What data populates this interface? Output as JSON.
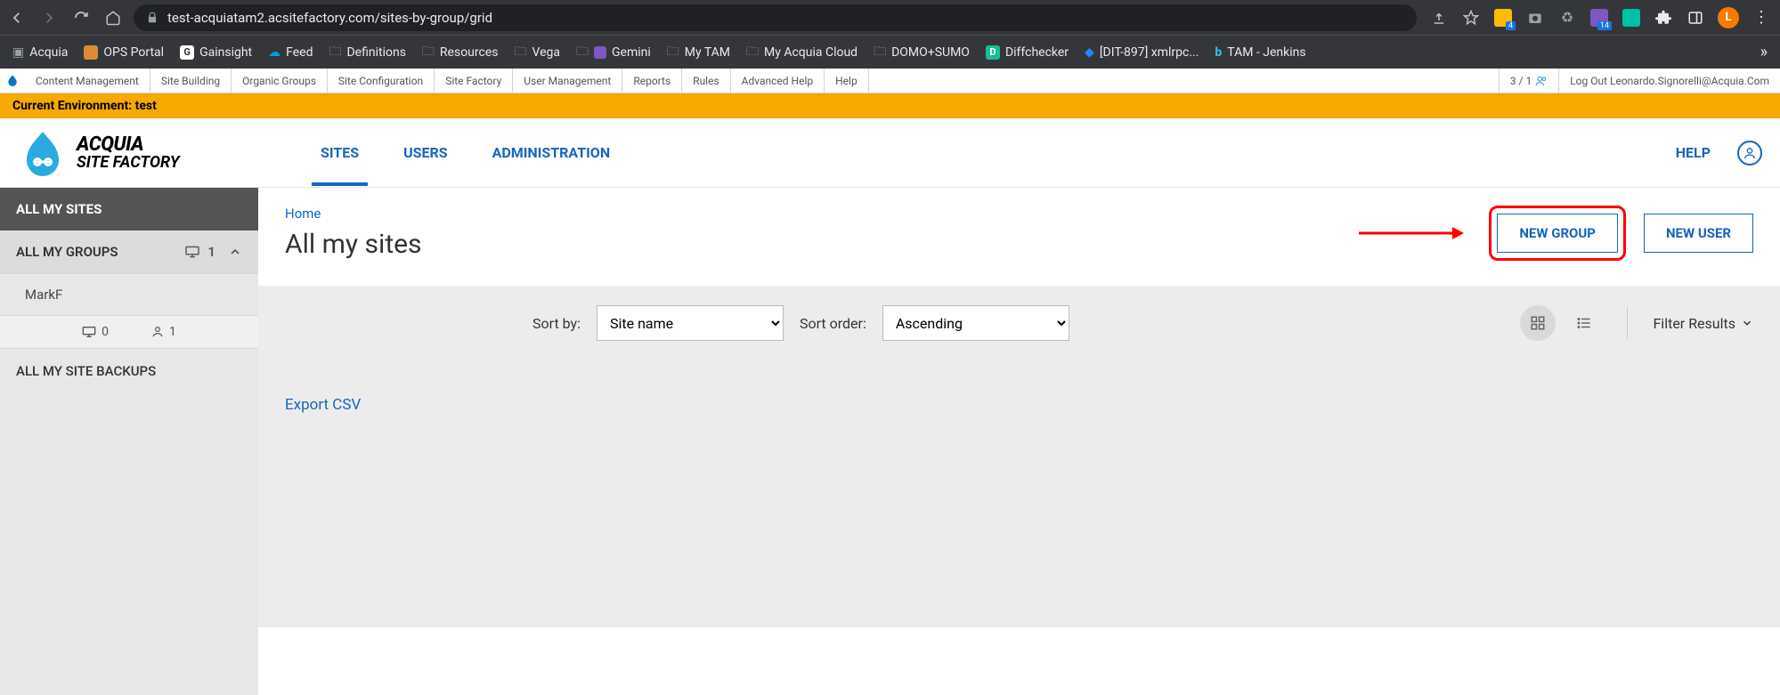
{
  "browser": {
    "url": "test-acquiatam2.acsitefactory.com/sites-by-group/grid",
    "avatar_letter": "L",
    "bookmarks": [
      {
        "label": "Acquia",
        "icon": "folder"
      },
      {
        "label": "OPS Portal",
        "icon": "orange"
      },
      {
        "label": "Gainsight",
        "icon": "white-g"
      },
      {
        "label": "Feed",
        "icon": "cloud-blue"
      },
      {
        "label": "Definitions",
        "icon": "folder"
      },
      {
        "label": "Resources",
        "icon": "folder"
      },
      {
        "label": "Vega",
        "icon": "folder"
      },
      {
        "label": "Gemini",
        "icon": "purple"
      },
      {
        "label": "My TAM",
        "icon": "folder"
      },
      {
        "label": "My Acquia Cloud",
        "icon": "folder"
      },
      {
        "label": "DOMO+SUMO",
        "icon": "folder"
      },
      {
        "label": "Diffchecker",
        "icon": "green-d"
      },
      {
        "label": "[DIT-897] xmlrpc...",
        "icon": "blue-diamond"
      },
      {
        "label": "TAM - Jenkins",
        "icon": "blue-b"
      }
    ]
  },
  "admin_bar": {
    "items": [
      "Content Management",
      "Site Building",
      "Organic Groups",
      "Site Configuration",
      "Site Factory",
      "User Management",
      "Reports",
      "Rules",
      "Advanced Help",
      "Help"
    ],
    "count": "3 / 1",
    "logout": "Log Out Leonardo.Signorelli@Acquia.Com"
  },
  "env_banner": "Current Environment: test",
  "header": {
    "logo_line1": "ACQUIA",
    "logo_line2": "SITE FACTORY",
    "tabs": [
      {
        "label": "SITES",
        "active": true
      },
      {
        "label": "USERS",
        "active": false
      },
      {
        "label": "ADMINISTRATION",
        "active": false
      }
    ],
    "help": "HELP"
  },
  "sidebar": {
    "all_sites": "ALL MY SITES",
    "all_groups": "ALL MY GROUPS",
    "groups_count": "1",
    "group_name": "MarkF",
    "sites_count": "0",
    "users_count": "1",
    "backups": "ALL MY SITE BACKUPS"
  },
  "main": {
    "breadcrumb": "Home",
    "title": "All my sites",
    "new_group": "NEW GROUP",
    "new_user": "NEW USER",
    "sort_by_label": "Sort by:",
    "sort_by_value": "Site name",
    "sort_order_label": "Sort order:",
    "sort_order_value": "Ascending",
    "filter": "Filter Results",
    "export": "Export CSV"
  }
}
